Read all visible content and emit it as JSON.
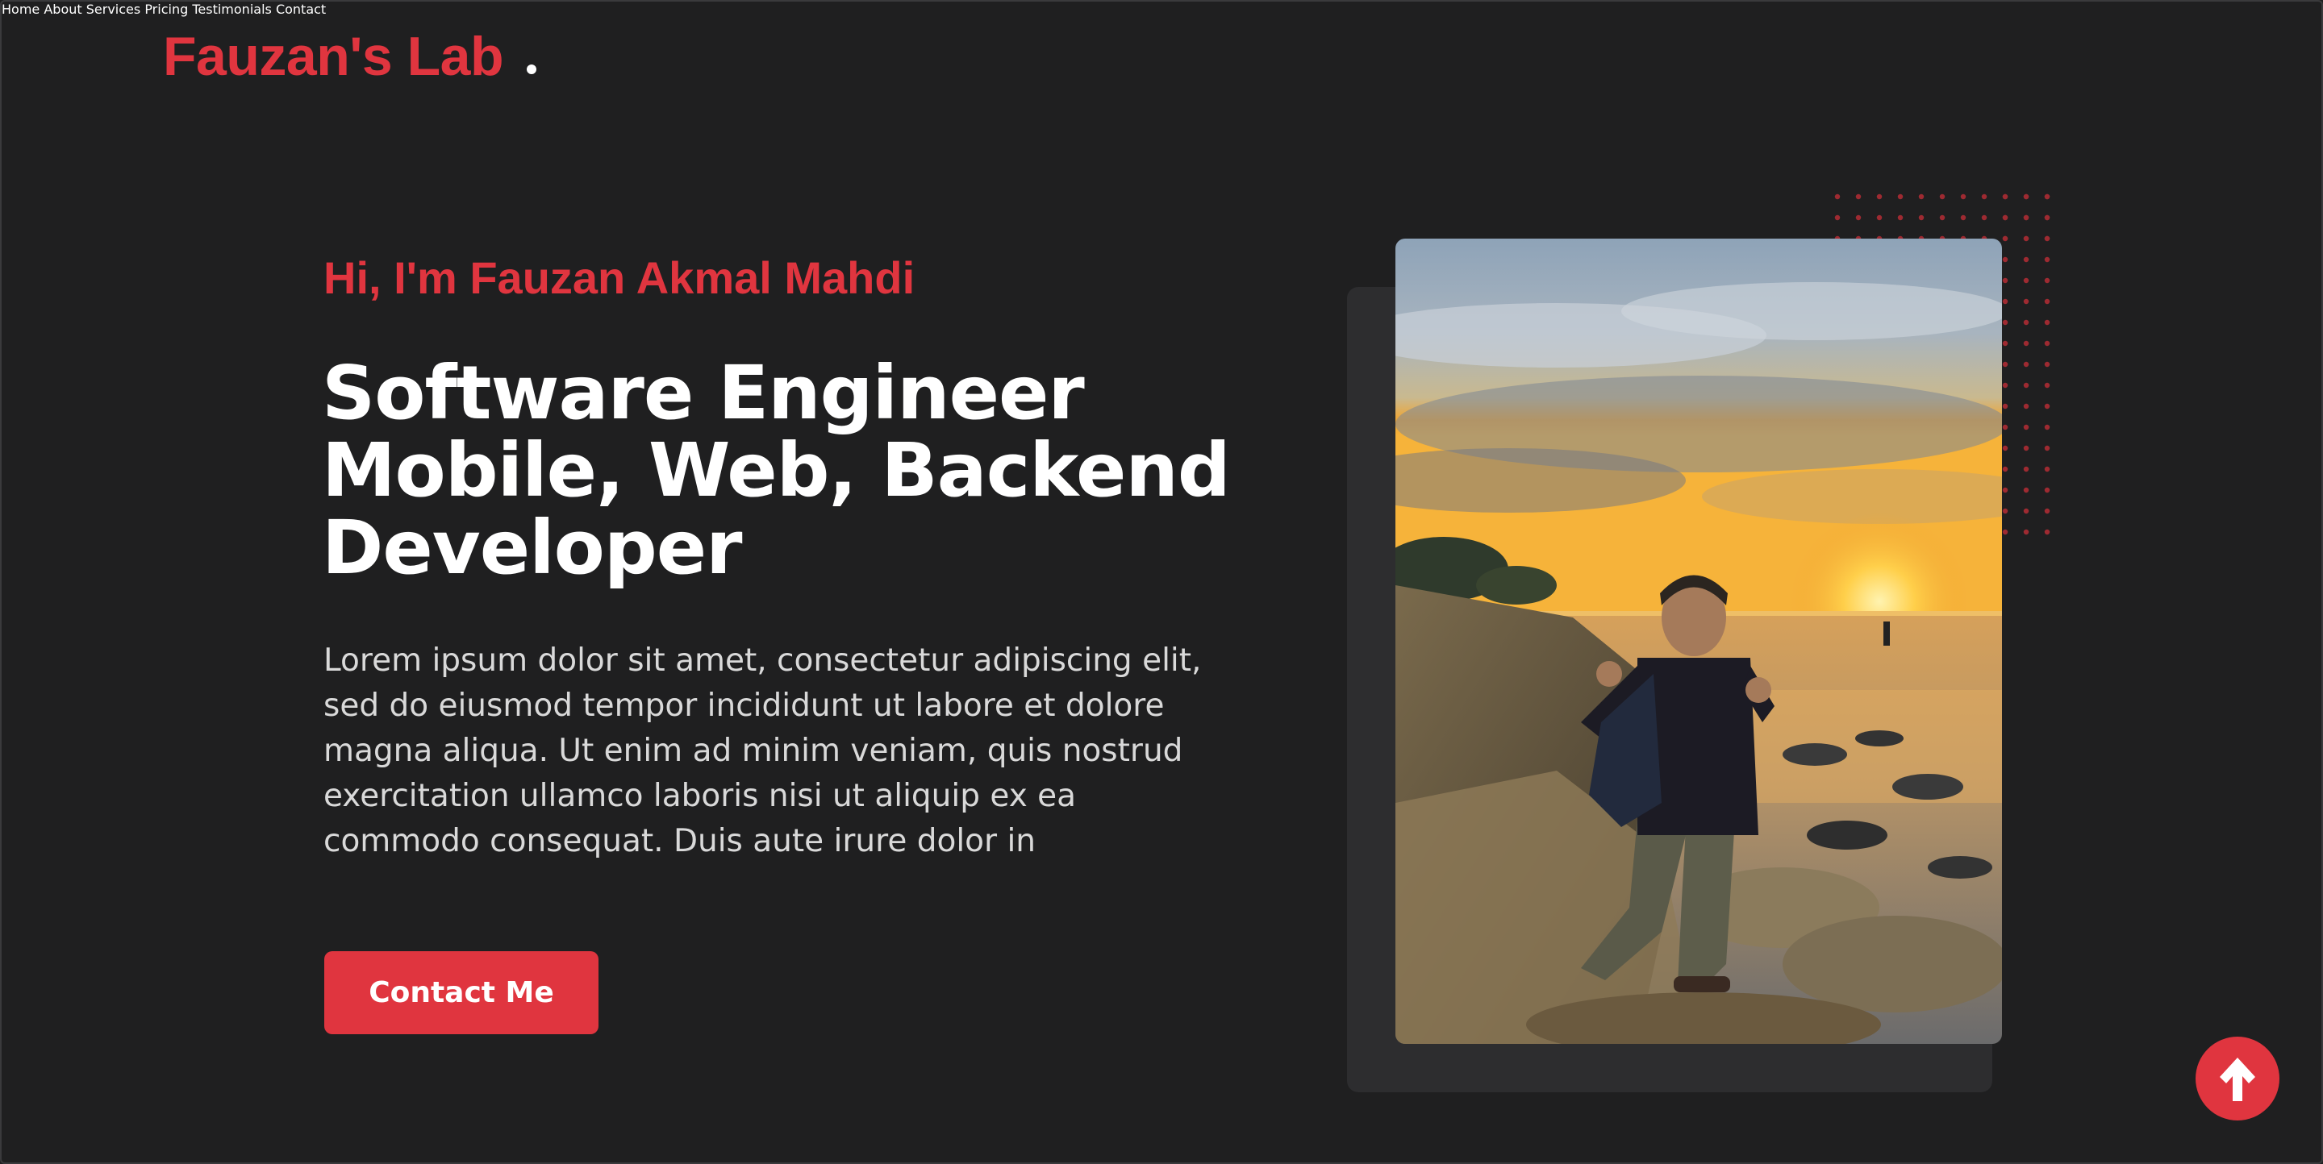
{
  "brand": {
    "name": "Fauzan's Lab",
    "accent_color": "#e0353f"
  },
  "nav": {
    "items": [
      {
        "label": "Home"
      },
      {
        "label": "About"
      },
      {
        "label": "Services"
      },
      {
        "label": "Pricing"
      },
      {
        "label": "Testimonials"
      },
      {
        "label": "Contact"
      }
    ]
  },
  "hero": {
    "greeting": "Hi, I'm Fauzan Akmal Mahdi",
    "headline_lines": [
      "Software Engineer",
      "Mobile, Web, Backend",
      "Developer"
    ],
    "paragraph_lines": [
      "Lorem ipsum dolor sit amet, consectetur adipiscing elit,",
      "sed do eiusmod tempor incididunt ut labore et dolore",
      "magna aliqua. Ut enim ad minim veniam, quis nostrud",
      "exercitation ullamco laboris nisi ut aliquip ex ea",
      "commodo consequat. Duis aute irure dolor in"
    ],
    "cta_label": "Contact Me"
  },
  "photo": {
    "icon": "profile-photo"
  },
  "scroll_top": {
    "icon": "arrow-up-icon"
  }
}
